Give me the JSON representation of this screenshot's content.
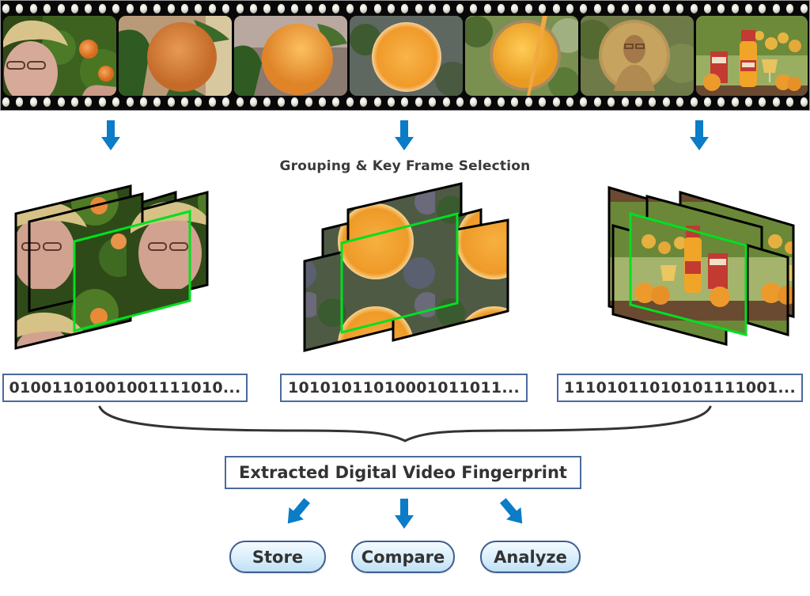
{
  "filmstrip": {
    "frames": [
      {
        "scene": "farmer-in-orange-grove"
      },
      {
        "scene": "orange-on-branch"
      },
      {
        "scene": "orange-closeup"
      },
      {
        "scene": "orange-slice"
      },
      {
        "scene": "juice-glass-overhead"
      },
      {
        "scene": "farmer-through-glass"
      },
      {
        "scene": "juice-product-display"
      }
    ]
  },
  "grouping": {
    "label": "Grouping & Key Frame Selection",
    "groups": [
      {
        "scene": "farmer-in-orange-grove",
        "key_frame_highlight": "#00e020"
      },
      {
        "scene": "orange-slice",
        "key_frame_highlight": "#00e020"
      },
      {
        "scene": "juice-product-display",
        "key_frame_highlight": "#00e020"
      }
    ]
  },
  "fingerprints": [
    {
      "bits": "01001101001001111010..."
    },
    {
      "bits": "10101011010001011011..."
    },
    {
      "bits": "11101011010101111001..."
    }
  ],
  "result": {
    "label": "Extracted Digital Video Fingerprint"
  },
  "actions": [
    {
      "label": "Store"
    },
    {
      "label": "Compare"
    },
    {
      "label": "Analyze"
    }
  ],
  "colors": {
    "arrow": "#0a7cc8",
    "box_border": "#4a6a9c",
    "key_frame_border": "#00e020",
    "button_fill": "#d9eefb"
  },
  "icons": {
    "flow_arrow": "arrow-down-icon"
  }
}
